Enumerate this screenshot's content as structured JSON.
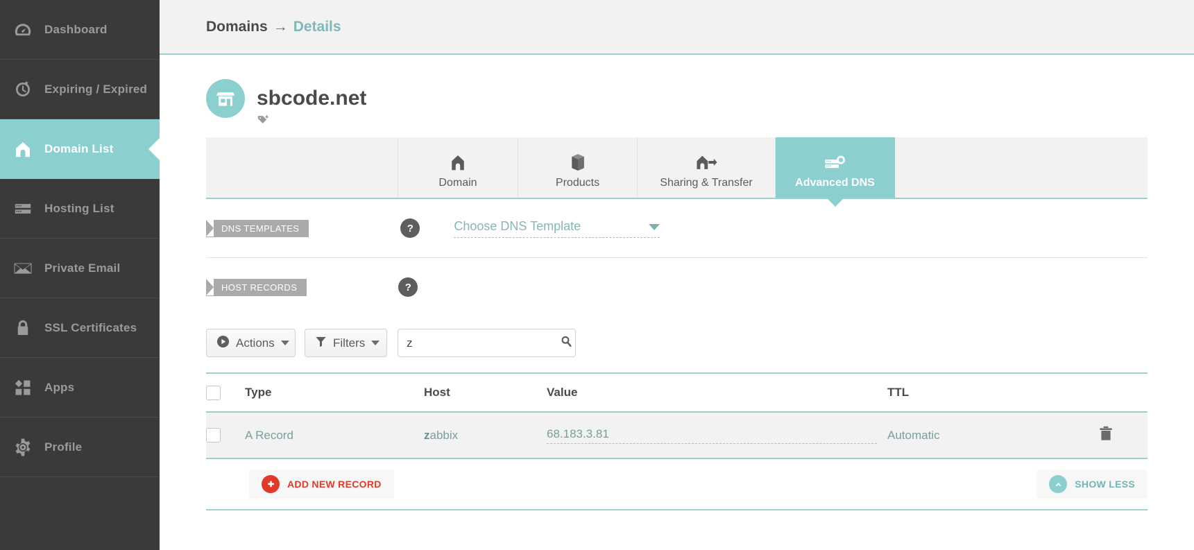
{
  "sidebar": {
    "items": [
      {
        "label": "Dashboard",
        "icon": "gauge-icon",
        "active": false
      },
      {
        "label": "Expiring / Expired",
        "icon": "stopwatch-icon",
        "active": false
      },
      {
        "label": "Domain List",
        "icon": "home-icon",
        "active": true
      },
      {
        "label": "Hosting List",
        "icon": "server-icon",
        "active": false
      },
      {
        "label": "Private Email",
        "icon": "envelope-icon",
        "active": false
      },
      {
        "label": "SSL Certificates",
        "icon": "lock-icon",
        "active": false
      },
      {
        "label": "Apps",
        "icon": "apps-icon",
        "active": false
      },
      {
        "label": "Profile",
        "icon": "gear-icon",
        "active": false
      }
    ]
  },
  "breadcrumb": {
    "root": "Domains",
    "separator": "→",
    "current": "Details"
  },
  "domain": {
    "name": "sbcode.net",
    "avatar_icon": "storefront-icon",
    "tag_icon": "add-tag-icon"
  },
  "tabs": [
    {
      "label": "Domain",
      "icon": "home-icon",
      "active": false
    },
    {
      "label": "Products",
      "icon": "box-icon",
      "active": false
    },
    {
      "label": "Sharing & Transfer",
      "icon": "share-transfer-icon",
      "active": false
    },
    {
      "label": "Advanced DNS",
      "icon": "dns-server-icon",
      "active": true
    }
  ],
  "dns_templates": {
    "ribbon_label": "DNS TEMPLATES",
    "help_label": "?",
    "select_placeholder": "Choose DNS Template",
    "select_value": ""
  },
  "host_records": {
    "ribbon_label": "HOST RECORDS",
    "help_label": "?"
  },
  "toolbar": {
    "actions_label": "Actions",
    "filters_label": "Filters",
    "search_value": "z",
    "search_placeholder": "",
    "search_icon": "magnifier-icon"
  },
  "table": {
    "columns": [
      "Type",
      "Host",
      "Value",
      "TTL"
    ],
    "rows": [
      {
        "type": "A Record",
        "host_match": "z",
        "host_rest": "abbix",
        "value": "68.183.3.81",
        "ttl": "Automatic",
        "delete_icon": "trash-icon"
      }
    ]
  },
  "footer": {
    "add_label": "ADD NEW RECORD",
    "add_icon": "plus-circle-icon",
    "show_less_label": "SHOW LESS",
    "show_less_icon": "chevron-up-circle-icon"
  },
  "colors": {
    "accent_teal": "#8ccfcf",
    "sidebar_bg": "#3a3a3a",
    "row_text": "#7a9e9c",
    "danger_red": "#e03a28"
  }
}
